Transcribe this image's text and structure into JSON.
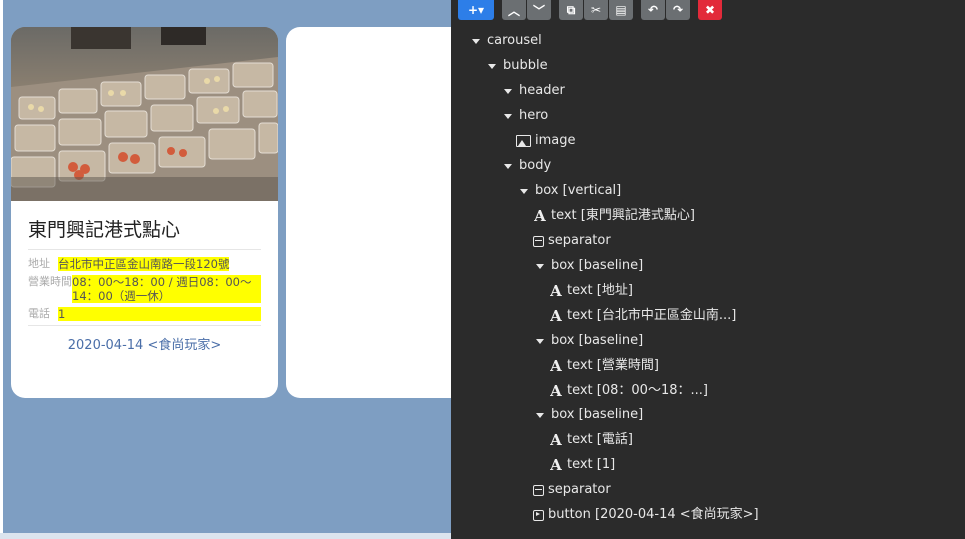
{
  "preview": {
    "card": {
      "title": "東門興記港式點心",
      "rows": [
        {
          "label": "地址",
          "value": "台北市中正區金山南路一段120號"
        },
        {
          "label": "營業時間",
          "value": "08：00～18：00 / 週日08：00～14：00（週一休）"
        },
        {
          "label": "電話",
          "value": "1"
        }
      ],
      "button_label": "2020-04-14 <食尚玩家>"
    },
    "colors": {
      "background": "#7e9ec2",
      "highlight": "#ffff00",
      "button_text": "#4a6ea8"
    }
  },
  "toolbar": {
    "add_icon": "plus-icon",
    "buttons": [
      "chevron-up-icon",
      "chevron-down-icon",
      "copy-icon",
      "cut-icon",
      "paste-icon",
      "undo-icon",
      "redo-icon",
      "delete-icon"
    ]
  },
  "tree": {
    "nodes": [
      {
        "label": "carousel",
        "type": "folder"
      },
      {
        "label": "bubble",
        "type": "folder"
      },
      {
        "label": "header",
        "type": "folder"
      },
      {
        "label": "hero",
        "type": "folder"
      },
      {
        "label": "image",
        "type": "image"
      },
      {
        "label": "body",
        "type": "folder"
      },
      {
        "label": "box [vertical]",
        "type": "folder"
      },
      {
        "label": "text [東門興記港式點心]",
        "type": "text"
      },
      {
        "label": "separator",
        "type": "separator"
      },
      {
        "label": "box [baseline]",
        "type": "folder"
      },
      {
        "label": "text [地址]",
        "type": "text"
      },
      {
        "label": "text [台北市中正區金山南...]",
        "type": "text"
      },
      {
        "label": "box [baseline]",
        "type": "folder"
      },
      {
        "label": "text [營業時間]",
        "type": "text"
      },
      {
        "label": "text [08：00～18：...]",
        "type": "text"
      },
      {
        "label": "box [baseline]",
        "type": "folder"
      },
      {
        "label": "text [電話]",
        "type": "text"
      },
      {
        "label": "text [1]",
        "type": "text"
      },
      {
        "label": "separator",
        "type": "separator"
      },
      {
        "label": "button [2020-04-14 <食尚玩家>]",
        "type": "button"
      }
    ]
  }
}
